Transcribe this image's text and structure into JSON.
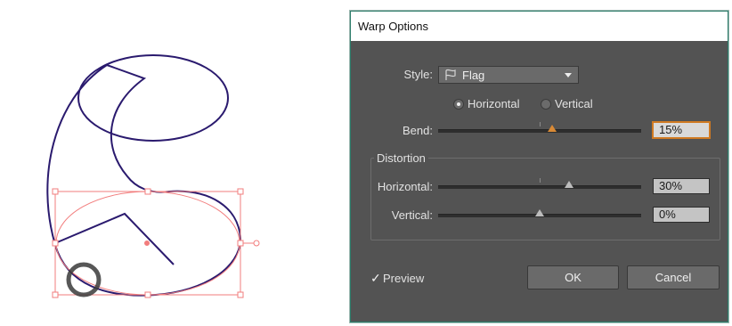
{
  "dialog": {
    "title": "Warp Options",
    "style": {
      "label": "Style:",
      "value": "Flag",
      "icon": "flag-icon"
    },
    "orientation": {
      "horizontal_label": "Horizontal",
      "vertical_label": "Vertical",
      "selected": "Horizontal"
    },
    "bend": {
      "label": "Bend:",
      "value": "15%",
      "level": 0.15
    },
    "distortion": {
      "group_label": "Distortion",
      "horizontal": {
        "label": "Horizontal:",
        "value": "30%",
        "level": 0.3
      },
      "vertical": {
        "label": "Vertical:",
        "value": "0%",
        "level": 0.0
      }
    },
    "preview": {
      "label": "Preview",
      "checked": true
    },
    "buttons": {
      "ok": "OK",
      "cancel": "Cancel"
    }
  },
  "colors": {
    "dialog_bg": "#535353",
    "path_stroke": "#2a1a6e",
    "selection": "#f27d7d",
    "accent_focus": "#d07a22"
  }
}
